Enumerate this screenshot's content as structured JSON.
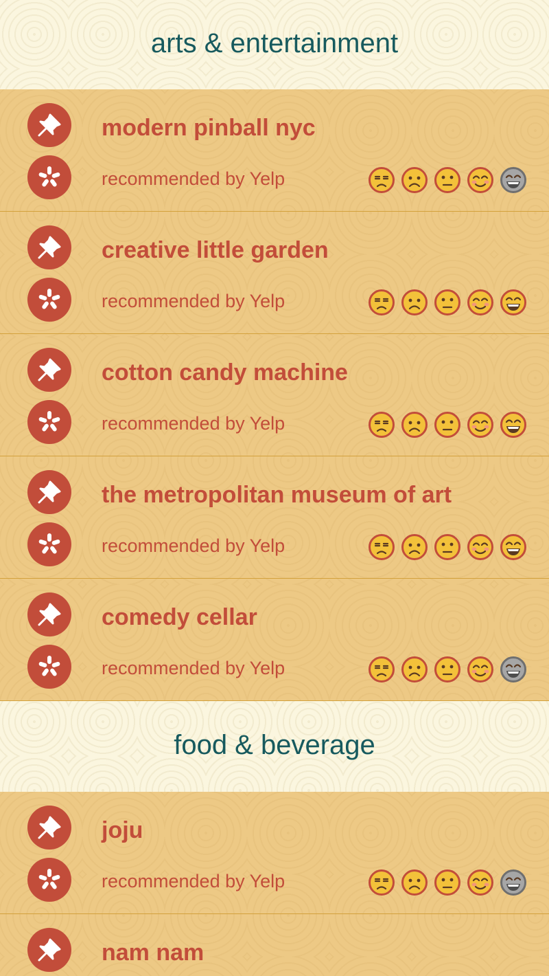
{
  "colors": {
    "accent": "#c24d3a",
    "heading": "#175a5e",
    "list_bg": "#edc985",
    "page_bg": "#fbf6df",
    "emoji_fill": "#f3c13a",
    "emoji_outline": "#c24d3a",
    "emoji_inactive": "#a6a6a6"
  },
  "sections": [
    {
      "title": "arts & entertainment",
      "items": [
        {
          "name": "modern pinball nyc",
          "recommendation": "recommended by Yelp",
          "ratings": [
            "unamused-face-icon",
            "frowning-face-icon",
            "neutral-face-icon",
            "smiling-face-icon",
            "grinning-face-icon"
          ],
          "rating_inactive": [
            false,
            false,
            false,
            false,
            true
          ]
        },
        {
          "name": "creative little garden",
          "recommendation": "recommended by Yelp",
          "ratings": [
            "unamused-face-icon",
            "frowning-face-icon",
            "neutral-face-icon",
            "smiling-face-icon",
            "grinning-face-icon"
          ],
          "rating_inactive": [
            false,
            false,
            false,
            false,
            false
          ]
        },
        {
          "name": "cotton candy machine",
          "recommendation": "recommended by Yelp",
          "ratings": [
            "unamused-face-icon",
            "frowning-face-icon",
            "neutral-face-icon",
            "smiling-face-icon",
            "grinning-face-icon"
          ],
          "rating_inactive": [
            false,
            false,
            false,
            false,
            false
          ]
        },
        {
          "name": "the metropolitan museum of art",
          "recommendation": "recommended by Yelp",
          "ratings": [
            "unamused-face-icon",
            "frowning-face-icon",
            "neutral-face-icon",
            "smiling-face-icon",
            "grinning-face-icon"
          ],
          "rating_inactive": [
            false,
            false,
            false,
            false,
            false
          ]
        },
        {
          "name": "comedy cellar",
          "recommendation": "recommended by Yelp",
          "ratings": [
            "unamused-face-icon",
            "frowning-face-icon",
            "neutral-face-icon",
            "smiling-face-icon",
            "grinning-face-icon"
          ],
          "rating_inactive": [
            false,
            false,
            false,
            false,
            true
          ]
        }
      ]
    },
    {
      "title": "food & beverage",
      "items": [
        {
          "name": "joju",
          "recommendation": "recommended by Yelp",
          "ratings": [
            "unamused-face-icon",
            "frowning-face-icon",
            "neutral-face-icon",
            "smiling-face-icon",
            "grinning-face-icon"
          ],
          "rating_inactive": [
            false,
            false,
            false,
            false,
            true
          ]
        },
        {
          "name": "nam nam"
        }
      ]
    }
  ],
  "icons": {
    "pin": "pushpin-icon",
    "yelp": "yelp-icon"
  }
}
